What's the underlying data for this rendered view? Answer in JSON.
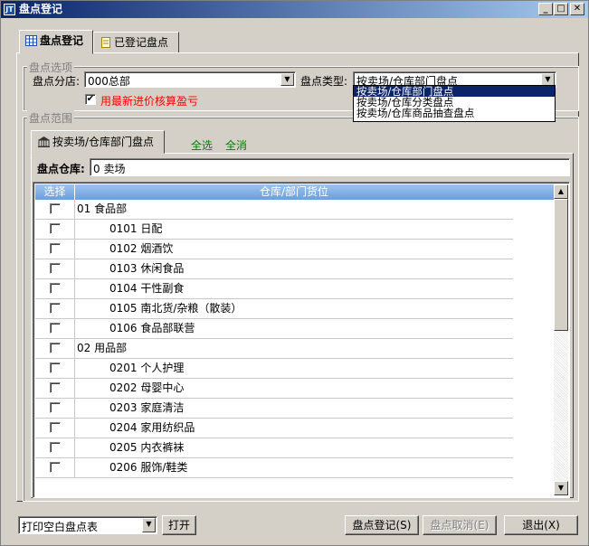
{
  "window": {
    "title": "盘点登记",
    "app_icon": "JT",
    "min_label": "_",
    "max_label": "□",
    "close_label": "✕"
  },
  "tabs": [
    {
      "label": "盘点登记",
      "icon": "grid-icon"
    },
    {
      "label": "已登记盘点",
      "icon": "document-icon"
    }
  ],
  "options": {
    "legend": "盘点选项",
    "branch_label": "盘点分店:",
    "branch_value": "000总部",
    "type_label": "盘点类型:",
    "type_value": "按卖场/仓库部门盘点",
    "type_options": [
      "按卖场/仓库部门盘点",
      "按卖场/仓库分类盘点",
      "按卖场/仓库商品抽查盘点"
    ],
    "latest_price_label": "用最新进价核算盈亏",
    "latest_price_checked": "✔"
  },
  "scope": {
    "legend": "盘点范围",
    "subtab_label": "按卖场/仓库部门盘点",
    "select_all": "全选",
    "clear_all": "全消",
    "warehouse_label": "盘点仓库:",
    "warehouse_value": "0 卖场"
  },
  "grid": {
    "col_select": "选择",
    "col_location": "仓库/部门货位",
    "rows": [
      {
        "name": "01 食品部",
        "level": 0
      },
      {
        "name": "0101 日配",
        "level": 1
      },
      {
        "name": "0102 烟酒饮",
        "level": 1
      },
      {
        "name": "0103 休闲食品",
        "level": 1
      },
      {
        "name": "0104 干性副食",
        "level": 1
      },
      {
        "name": "0105 南北货/杂粮（散装）",
        "level": 1
      },
      {
        "name": "0106 食品部联营",
        "level": 1
      },
      {
        "name": "02 用品部",
        "level": 0
      },
      {
        "name": "0201 个人护理",
        "level": 1
      },
      {
        "name": "0202 母婴中心",
        "level": 1
      },
      {
        "name": "0203 家庭清洁",
        "level": 1
      },
      {
        "name": "0204 家用纺织品",
        "level": 1
      },
      {
        "name": "0205 内衣裤袜",
        "level": 1
      },
      {
        "name": "0206 服饰/鞋类",
        "level": 1
      }
    ]
  },
  "footer": {
    "print_value": "打印空白盘点表",
    "open_label": "打开",
    "register_label": "盘点登记(S)",
    "cancel_label": "盘点取消(E)",
    "exit_label": "退出(X)"
  }
}
